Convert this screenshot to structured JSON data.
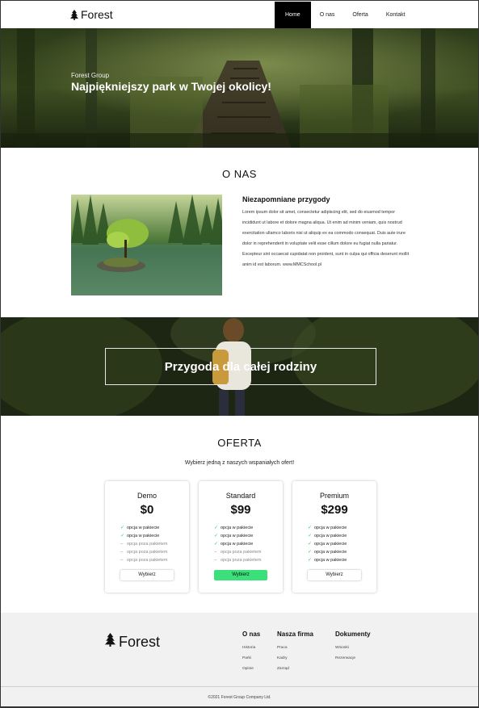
{
  "nav": {
    "logo": "Forest",
    "items": [
      {
        "label": "Home",
        "active": true
      },
      {
        "label": "O nas",
        "active": false
      },
      {
        "label": "Oferta",
        "active": false
      },
      {
        "label": "Kontakt",
        "active": false
      }
    ]
  },
  "hero": {
    "subtitle": "Forest Group",
    "title": "Najpiękniejszy park w Twojej okolicy!"
  },
  "about": {
    "section_title": "O NAS",
    "heading": "Niezapomniane przygody",
    "text": "Lorem ipsum dolor sit amet, consectetur adipiscing elit, sed do eiusmod tempor incididunt ut labore et dolore magna aliqua. Ut enim ad minim veniam, quis nostrud exercitation ullamco laboris nisi ut aliquip ex ea commodo consequat. Duis aute irure dolor in reprehenderit in voluptate velit esse cillum dolore eu fugiat nulla pariatur. Excepteur sint occaecat cupidatat non proident, sunt in culpa qui officia deserunt mollit anim id est laborum. www.MMCSchool.pl"
  },
  "banner": {
    "text": "Przygoda dla całej rodziny"
  },
  "offer": {
    "section_title": "OFERTA",
    "subtitle": "Wybierz jedną z naszych wspaniałych ofert!",
    "cards": [
      {
        "name": "Demo",
        "price": "$0",
        "button": "Wybierz",
        "highlight": false,
        "features": [
          {
            "text": "opcja w pakiecie",
            "included": true
          },
          {
            "text": "opcja w pakiecie",
            "included": true
          },
          {
            "text": "opcja poza pakietem",
            "included": false
          },
          {
            "text": "opcja poza pakietem",
            "included": false
          },
          {
            "text": "opcja poza pakietem",
            "included": false
          }
        ]
      },
      {
        "name": "Standard",
        "price": "$99",
        "button": "Wybierz",
        "highlight": true,
        "features": [
          {
            "text": "opcja w pakiecie",
            "included": true
          },
          {
            "text": "opcja w pakiecie",
            "included": true
          },
          {
            "text": "opcja w pakiecie",
            "included": true
          },
          {
            "text": "opcja poza pakietem",
            "included": false
          },
          {
            "text": "opcja poza pakietem",
            "included": false
          }
        ]
      },
      {
        "name": "Premium",
        "price": "$299",
        "button": "Wybierz",
        "highlight": false,
        "features": [
          {
            "text": "opcja w pakiecie",
            "included": true
          },
          {
            "text": "opcja w pakiecie",
            "included": true
          },
          {
            "text": "opcja w pakiecie",
            "included": true
          },
          {
            "text": "opcja w pakiecie",
            "included": true
          },
          {
            "text": "opcja w pakiecie",
            "included": true
          }
        ]
      }
    ]
  },
  "footer": {
    "logo": "Forest",
    "columns": [
      {
        "title": "O nas",
        "links": [
          "Historia",
          "Parki",
          "Opinie"
        ]
      },
      {
        "title": "Nasza firma",
        "links": [
          "Praca",
          "Kadry",
          "Zarząd"
        ]
      },
      {
        "title": "Dokumenty",
        "links": [
          "Wnioski",
          "Rezerwacje"
        ]
      }
    ],
    "copyright": "©2021 Forest Group Company Ltd."
  },
  "colors": {
    "accent_green": "#3be07a",
    "nav_active_bg": "#000000",
    "footer_bg": "#f1f1f1"
  },
  "icons": {
    "logo_icon": "tree-icon",
    "included_icon": "check-icon",
    "excluded_icon": "dash-icon"
  }
}
